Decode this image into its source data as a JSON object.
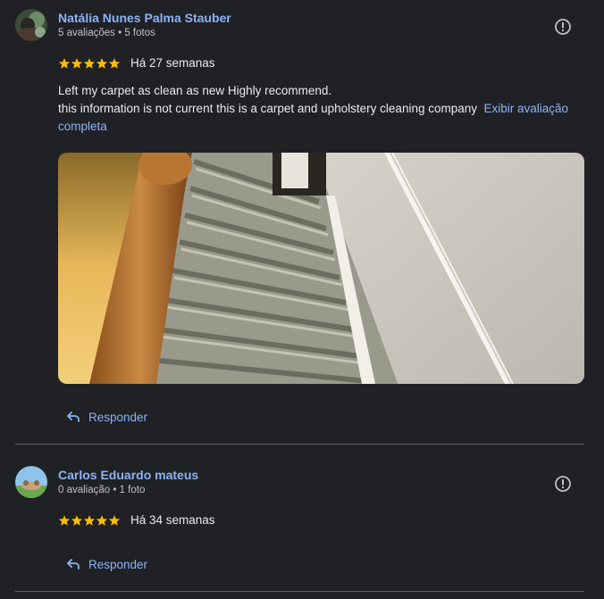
{
  "reviews": [
    {
      "author": "Natália Nunes Palma Stauber",
      "meta": "5 avaliações • 5 fotos",
      "rating": 5,
      "time": "Há 27 semanas",
      "text_line1": "Left my carpet as clean as new Highly recommend.",
      "text_line2": "this information is not current this is a carpet and upholstery cleaning company",
      "more_link": "Exibir avaliação completa",
      "reply_label": "Responder"
    },
    {
      "author": "Carlos Eduardo mateus",
      "meta": "0 avaliação • 1 foto",
      "rating": 5,
      "time": "Há 34 semanas",
      "reply_label": "Responder"
    }
  ],
  "colors": {
    "background": "#202124",
    "link": "#8ab4f8",
    "star": "#fbbc04",
    "divider": "#5f6368"
  },
  "icons": {
    "report": "exclamation-circle-icon",
    "reply": "reply-arrow-icon",
    "star": "star-icon"
  }
}
